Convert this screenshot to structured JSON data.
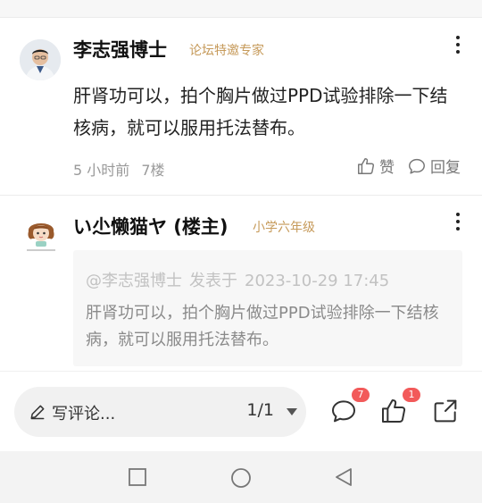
{
  "posts": [
    {
      "username": "李志强博士",
      "tag": "论坛特邀专家",
      "content": "肝肾功可以，拍个胸片做过PPD试验排除一下结核病，就可以服用托法替布。",
      "time": "5 小时前",
      "floor": "7楼",
      "like_label": "赞",
      "reply_label": "回复"
    },
    {
      "username": "い尐懒猫ヤ (楼主)",
      "tag": "小学六年级",
      "quote": {
        "author": "@李志强博士",
        "posted_label": "发表于",
        "datetime": "2023-10-29 17:45",
        "text": "肝肾功可以，拍个胸片做过PPD试验排除一下结核病，就可以服用托法替布。"
      }
    }
  ],
  "bottom_bar": {
    "comment_placeholder": "写评论...",
    "page_indicator": "1/1",
    "comment_count": "7",
    "like_count": "1"
  },
  "colors": {
    "tag": "#c69a5a",
    "badge": "#f25a5a",
    "quote_bg": "#f7f7f7"
  },
  "icons": [
    "more-icon",
    "like-icon",
    "reply-icon",
    "pen-icon",
    "comment-icon",
    "thumb-up-icon",
    "share-icon",
    "nav-recent-icon",
    "nav-home-icon",
    "nav-back-icon"
  ]
}
